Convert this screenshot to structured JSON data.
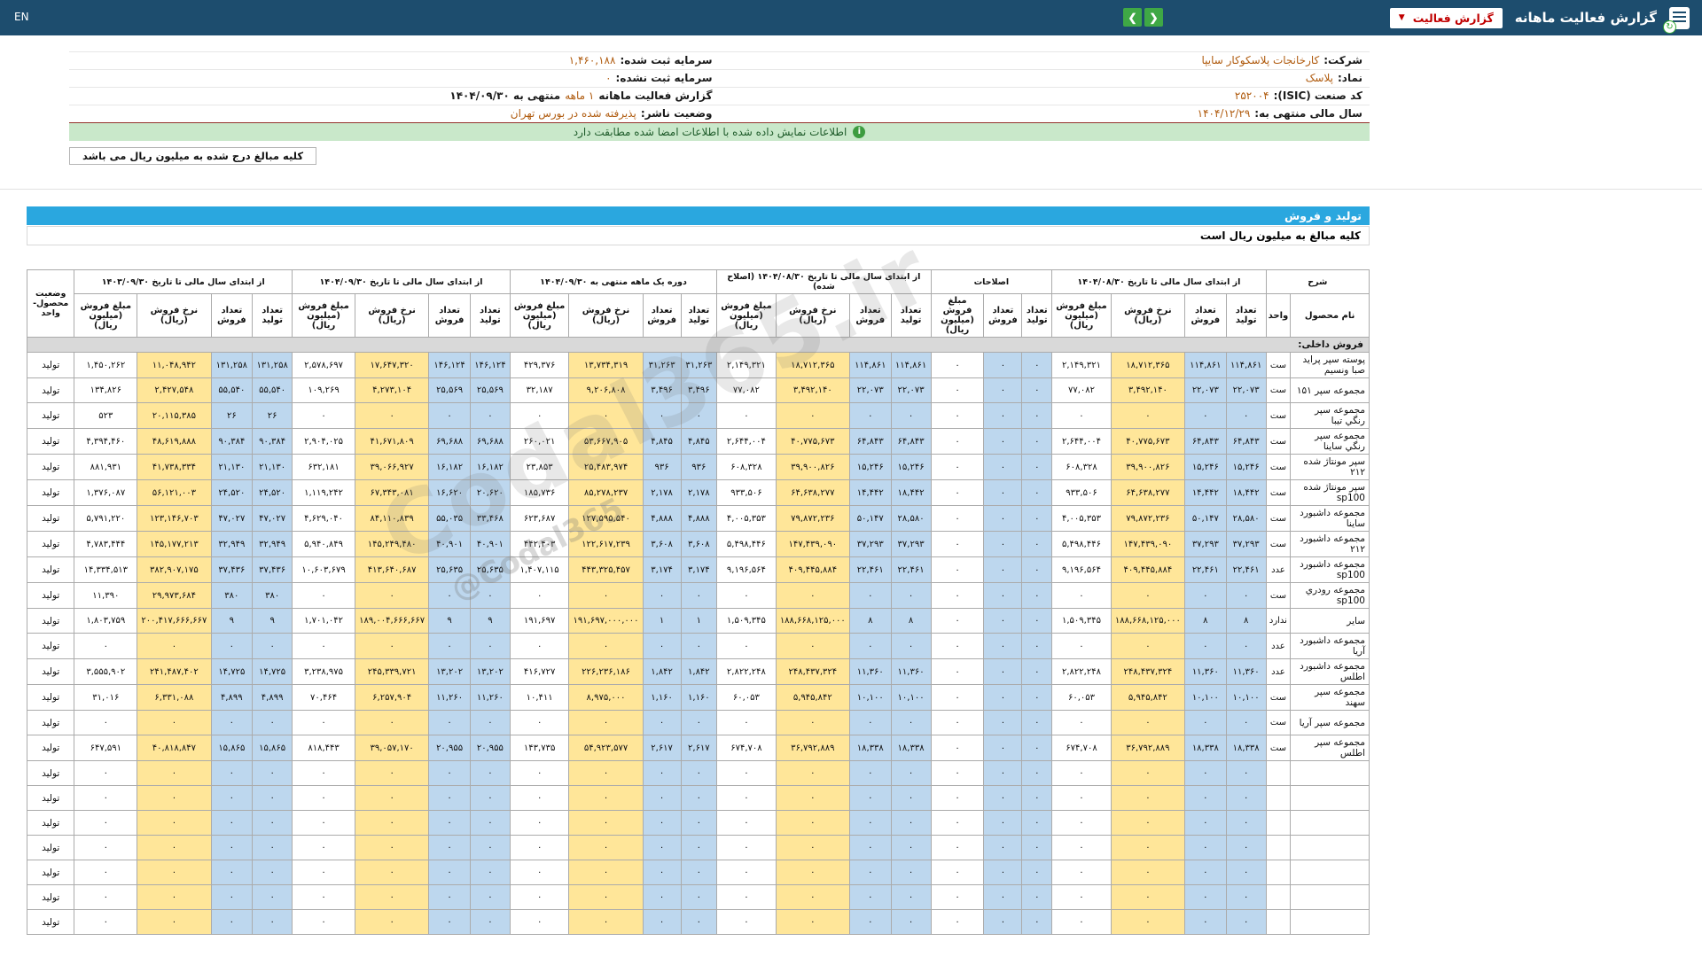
{
  "colors": {
    "navbar_bg": "#1d4d6e",
    "section_bar": "#2aa7df",
    "count_cell": "#bdd7ee",
    "rate_cell": "#ffe699",
    "accent_red": "#c00000",
    "value_orange": "#b05c10",
    "green_button": "#3fa845",
    "notice_bg": "#c9e8ca",
    "section_row_bg": "#d9d9d9"
  },
  "icons": {
    "chevron_down": "▼",
    "prev": "❮",
    "next": "❯",
    "info": "i",
    "refresh": "↻"
  },
  "navbar": {
    "title": "گزارش فعالیت ماهانه",
    "report_select": "گزارش فعالیت",
    "lang": "EN"
  },
  "company": {
    "right": [
      {
        "label": "شرکت:",
        "value": "کارخانجات پلاسکوکار سایپا"
      },
      {
        "label": "نماد:",
        "value": "پلاسک"
      },
      {
        "label": "کد صنعت (ISIC):",
        "value": "۲۵۲۰۰۴"
      },
      {
        "label": "سال مالی منتهی به:",
        "value": "۱۴۰۴/۱۲/۲۹"
      }
    ],
    "left": [
      {
        "label": "سرمایه ثبت شده:",
        "value": "۱,۴۶۰,۱۸۸"
      },
      {
        "label": "سرمایه ثبت نشده:",
        "value": "۰"
      },
      {
        "pre": "گزارش فعالیت ماهانه",
        "mid": "۱ ماهه",
        "suf": "منتهی به ۱۴۰۴/۰۹/۳۰"
      },
      {
        "label": "وضعیت ناشر:",
        "value": "پذیرفته شده در بورس تهران"
      }
    ]
  },
  "notice": "اطلاعات نمایش داده شده با اطلاعات امضا شده مطابقت دارد",
  "amounts_chip": "کلیه مبالغ درج شده به میلیون ریال می باشد",
  "section": {
    "title": "تولید و فروش",
    "note": "کلیه مبالغ به میلیون ریال است"
  },
  "watermark": {
    "main": "Codal365.ir",
    "sub": "@Codal365"
  },
  "table": {
    "desc_header": "شرح",
    "desc_cols": [
      "نام محصول",
      "واحد"
    ],
    "status_header": "وضعیت\nمحصول-واحد",
    "groups": [
      {
        "title": "از ابتدای سال مالی تا تاریخ ۱۴۰۴/۰۸/۳۰",
        "cols": [
          "تعداد تولید",
          "تعداد فروش",
          "نرخ فروش (ریال)",
          "مبلغ فروش (میلیون ریال)"
        ]
      },
      {
        "title": "اصلاحات",
        "cols": [
          "تعداد تولید",
          "تعداد فروش",
          "مبلغ فروش (میلیون ریال)"
        ]
      },
      {
        "title": "از ابتدای سال مالی تا تاریخ ۱۴۰۴/۰۸/۳۰ (اصلاح شده)",
        "cols": [
          "تعداد تولید",
          "تعداد فروش",
          "نرخ فروش (ریال)",
          "مبلغ فروش (میلیون ریال)"
        ]
      },
      {
        "title": "دوره یک ماهه منتهی به ۱۴۰۴/۰۹/۳۰",
        "cols": [
          "تعداد تولید",
          "تعداد فروش",
          "نرخ فروش (ریال)",
          "مبلغ فروش (میلیون ریال)"
        ]
      },
      {
        "title": "از ابتدای سال مالی تا تاریخ ۱۴۰۴/۰۹/۳۰",
        "cols": [
          "تعداد تولید",
          "تعداد فروش",
          "نرخ فروش (ریال)",
          "مبلغ فروش (میلیون ریال)"
        ]
      },
      {
        "title": "از ابتدای سال مالی تا تاریخ ۱۴۰۳/۰۹/۳۰",
        "cols": [
          "تعداد تولید",
          "تعداد فروش",
          "نرخ فروش (ریال)",
          "مبلغ فروش (میلیون ریال)"
        ]
      }
    ],
    "section_row": "فروش داخلی:",
    "rows": [
      {
        "name": "پوسته سپر پرايد صبا ونسيم",
        "unit": "ست",
        "status": "تولید",
        "g": [
          [
            "۱۱۴,۸۶۱",
            "۱۱۴,۸۶۱",
            "۱۸,۷۱۲,۳۶۵",
            "۲,۱۴۹,۳۲۱"
          ],
          [
            "۰",
            "۰",
            "۰"
          ],
          [
            "۱۱۴,۸۶۱",
            "۱۱۴,۸۶۱",
            "۱۸,۷۱۲,۳۶۵",
            "۲,۱۴۹,۳۲۱"
          ],
          [
            "۳۱,۲۶۳",
            "۳۱,۲۶۳",
            "۱۳,۷۳۴,۳۱۹",
            "۴۲۹,۳۷۶"
          ],
          [
            "۱۴۶,۱۲۴",
            "۱۴۶,۱۲۴",
            "۱۷,۶۴۷,۳۲۰",
            "۲,۵۷۸,۶۹۷"
          ],
          [
            "۱۳۱,۲۵۸",
            "۱۳۱,۲۵۸",
            "۱۱,۰۴۸,۹۴۲",
            "۱,۴۵۰,۲۶۲"
          ]
        ]
      },
      {
        "name": "مجموعه سپر ۱۵۱",
        "unit": "ست",
        "status": "تولید",
        "g": [
          [
            "۲۲,۰۷۳",
            "۲۲,۰۷۳",
            "۳,۴۹۲,۱۴۰",
            "۷۷,۰۸۲"
          ],
          [
            "۰",
            "۰",
            "۰"
          ],
          [
            "۲۲,۰۷۳",
            "۲۲,۰۷۳",
            "۳,۴۹۲,۱۴۰",
            "۷۷,۰۸۲"
          ],
          [
            "۳,۴۹۶",
            "۳,۴۹۶",
            "۹,۲۰۶,۸۰۸",
            "۳۲,۱۸۷"
          ],
          [
            "۲۵,۵۶۹",
            "۲۵,۵۶۹",
            "۴,۲۷۳,۱۰۴",
            "۱۰۹,۲۶۹"
          ],
          [
            "۵۵,۵۴۰",
            "۵۵,۵۴۰",
            "۲,۴۲۷,۵۴۸",
            "۱۳۴,۸۲۶"
          ]
        ]
      },
      {
        "name": "مجموعه سپر رنگي تيبا",
        "unit": "ست",
        "status": "تولید",
        "g": [
          [
            "۰",
            "۰",
            "۰",
            "۰"
          ],
          [
            "۰",
            "۰",
            "۰"
          ],
          [
            "۰",
            "۰",
            "۰",
            "۰"
          ],
          [
            "۰",
            "۰",
            "۰",
            "۰"
          ],
          [
            "۰",
            "۰",
            "۰",
            "۰"
          ],
          [
            "۲۶",
            "۲۶",
            "۲۰,۱۱۵,۳۸۵",
            "۵۲۳"
          ]
        ]
      },
      {
        "name": "مجموعه سپر رنگي ساينا",
        "unit": "ست",
        "status": "تولید",
        "g": [
          [
            "۶۴,۸۴۳",
            "۶۴,۸۴۳",
            "۴۰,۷۷۵,۶۷۳",
            "۲,۶۴۴,۰۰۴"
          ],
          [
            "۰",
            "۰",
            "۰"
          ],
          [
            "۶۴,۸۴۳",
            "۶۴,۸۴۳",
            "۴۰,۷۷۵,۶۷۳",
            "۲,۶۴۴,۰۰۴"
          ],
          [
            "۴,۸۴۵",
            "۴,۸۴۵",
            "۵۳,۶۶۷,۹۰۵",
            "۲۶۰,۰۲۱"
          ],
          [
            "۶۹,۶۸۸",
            "۶۹,۶۸۸",
            "۴۱,۶۷۱,۸۰۹",
            "۲,۹۰۴,۰۲۵"
          ],
          [
            "۹۰,۳۸۴",
            "۹۰,۳۸۴",
            "۴۸,۶۱۹,۸۸۸",
            "۴,۳۹۴,۴۶۰"
          ]
        ]
      },
      {
        "name": "سپر مونتاژ شده ۲۱۲",
        "unit": "ست",
        "status": "تولید",
        "g": [
          [
            "۱۵,۲۴۶",
            "۱۵,۲۴۶",
            "۳۹,۹۰۰,۸۲۶",
            "۶۰۸,۳۲۸"
          ],
          [
            "۰",
            "۰",
            "۰"
          ],
          [
            "۱۵,۲۴۶",
            "۱۵,۲۴۶",
            "۳۹,۹۰۰,۸۲۶",
            "۶۰۸,۳۲۸"
          ],
          [
            "۹۳۶",
            "۹۳۶",
            "۲۵,۴۸۳,۹۷۴",
            "۲۳,۸۵۳"
          ],
          [
            "۱۶,۱۸۲",
            "۱۶,۱۸۲",
            "۳۹,۰۶۶,۹۲۷",
            "۶۳۲,۱۸۱"
          ],
          [
            "۲۱,۱۳۰",
            "۲۱,۱۳۰",
            "۴۱,۷۳۸,۳۳۴",
            "۸۸۱,۹۳۱"
          ]
        ]
      },
      {
        "name": "سپر مونتاژ شده sp100",
        "unit": "ست",
        "status": "تولید",
        "g": [
          [
            "۱۸,۴۴۲",
            "۱۴,۴۴۲",
            "۶۴,۶۳۸,۲۷۷",
            "۹۳۳,۵۰۶"
          ],
          [
            "۰",
            "۰",
            "۰"
          ],
          [
            "۱۸,۴۴۲",
            "۱۴,۴۴۲",
            "۶۴,۶۳۸,۲۷۷",
            "۹۳۳,۵۰۶"
          ],
          [
            "۲,۱۷۸",
            "۲,۱۷۸",
            "۸۵,۲۷۸,۲۳۷",
            "۱۸۵,۷۳۶"
          ],
          [
            "۲۰,۶۲۰",
            "۱۶,۶۲۰",
            "۶۷,۳۴۳,۰۸۱",
            "۱,۱۱۹,۲۴۲"
          ],
          [
            "۲۴,۵۲۰",
            "۲۴,۵۲۰",
            "۵۶,۱۲۱,۰۰۳",
            "۱,۳۷۶,۰۸۷"
          ]
        ]
      },
      {
        "name": "مجموعه داشبورد ساينا",
        "unit": "ست",
        "status": "تولید",
        "g": [
          [
            "۲۸,۵۸۰",
            "۵۰,۱۴۷",
            "۷۹,۸۷۲,۲۳۶",
            "۴,۰۰۵,۳۵۳"
          ],
          [
            "۰",
            "۰",
            "۰"
          ],
          [
            "۲۸,۵۸۰",
            "۵۰,۱۴۷",
            "۷۹,۸۷۲,۲۳۶",
            "۴,۰۰۵,۳۵۳"
          ],
          [
            "۴,۸۸۸",
            "۴,۸۸۸",
            "۱۲۷,۵۹۵,۵۴۰",
            "۶۲۳,۶۸۷"
          ],
          [
            "۳۳,۴۶۸",
            "۵۵,۰۳۵",
            "۸۴,۱۱۰,۸۳۹",
            "۴,۶۲۹,۰۴۰"
          ],
          [
            "۴۷,۰۲۷",
            "۴۷,۰۲۷",
            "۱۲۳,۱۴۶,۷۰۳",
            "۵,۷۹۱,۲۲۰"
          ]
        ]
      },
      {
        "name": "مجموعه داشبورد ۲۱۲",
        "unit": "ست",
        "status": "تولید",
        "g": [
          [
            "۳۷,۲۹۳",
            "۳۷,۲۹۳",
            "۱۴۷,۴۳۹,۰۹۰",
            "۵,۴۹۸,۴۴۶"
          ],
          [
            "۰",
            "۰",
            "۰"
          ],
          [
            "۳۷,۲۹۳",
            "۳۷,۲۹۳",
            "۱۴۷,۴۳۹,۰۹۰",
            "۵,۴۹۸,۴۴۶"
          ],
          [
            "۳,۶۰۸",
            "۳,۶۰۸",
            "۱۲۲,۶۱۷,۲۳۹",
            "۴۴۲,۴۰۳"
          ],
          [
            "۴۰,۹۰۱",
            "۴۰,۹۰۱",
            "۱۴۵,۲۴۹,۴۸۰",
            "۵,۹۴۰,۸۴۹"
          ],
          [
            "۳۲,۹۴۹",
            "۳۲,۹۴۹",
            "۱۴۵,۱۷۷,۲۱۳",
            "۴,۷۸۳,۴۴۴"
          ]
        ]
      },
      {
        "name": "مجموعه داشبورد sp100",
        "unit": "عدد",
        "status": "تولید",
        "g": [
          [
            "۲۲,۴۶۱",
            "۲۲,۴۶۱",
            "۴۰۹,۴۴۵,۸۸۴",
            "۹,۱۹۶,۵۶۴"
          ],
          [
            "۰",
            "۰",
            "۰"
          ],
          [
            "۲۲,۴۶۱",
            "۲۲,۴۶۱",
            "۴۰۹,۴۴۵,۸۸۴",
            "۹,۱۹۶,۵۶۴"
          ],
          [
            "۳,۱۷۴",
            "۳,۱۷۴",
            "۴۴۳,۳۲۵,۴۵۷",
            "۱,۴۰۷,۱۱۵"
          ],
          [
            "۲۵,۶۳۵",
            "۲۵,۶۳۵",
            "۴۱۳,۶۴۰,۶۸۷",
            "۱۰,۶۰۳,۶۷۹"
          ],
          [
            "۳۷,۴۳۶",
            "۳۷,۴۳۶",
            "۳۸۲,۹۰۷,۱۷۵",
            "۱۴,۳۳۴,۵۱۳"
          ]
        ]
      },
      {
        "name": "مجموعه رودري sp100",
        "unit": "ست",
        "status": "تولید",
        "g": [
          [
            "۰",
            "۰",
            "۰",
            "۰"
          ],
          [
            "۰",
            "۰",
            "۰"
          ],
          [
            "۰",
            "۰",
            "۰",
            "۰"
          ],
          [
            "۰",
            "۰",
            "۰",
            "۰"
          ],
          [
            "۰",
            "۰",
            "۰",
            "۰"
          ],
          [
            "۳۸۰",
            "۳۸۰",
            "۲۹,۹۷۳,۶۸۴",
            "۱۱,۳۹۰"
          ]
        ]
      },
      {
        "name": "ساير",
        "unit": "ندارد",
        "status": "تولید",
        "g": [
          [
            "۸",
            "۸",
            "۱۸۸,۶۶۸,۱۲۵,۰۰۰",
            "۱,۵۰۹,۳۴۵"
          ],
          [
            "۰",
            "۰",
            "۰"
          ],
          [
            "۸",
            "۸",
            "۱۸۸,۶۶۸,۱۲۵,۰۰۰",
            "۱,۵۰۹,۳۴۵"
          ],
          [
            "۱",
            "۱",
            "۱۹۱,۶۹۷,۰۰۰,۰۰۰",
            "۱۹۱,۶۹۷"
          ],
          [
            "۹",
            "۹",
            "۱۸۹,۰۰۴,۶۶۶,۶۶۷",
            "۱,۷۰۱,۰۴۲"
          ],
          [
            "۹",
            "۹",
            "۲۰۰,۴۱۷,۶۶۶,۶۶۷",
            "۱,۸۰۳,۷۵۹"
          ]
        ]
      },
      {
        "name": "مجموعه داشبورد آريا",
        "unit": "عدد",
        "status": "تولید",
        "g": [
          [
            "۰",
            "۰",
            "۰",
            "۰"
          ],
          [
            "۰",
            "۰",
            "۰"
          ],
          [
            "۰",
            "۰",
            "۰",
            "۰"
          ],
          [
            "۰",
            "۰",
            "۰",
            "۰"
          ],
          [
            "۰",
            "۰",
            "۰",
            "۰"
          ],
          [
            "۰",
            "۰",
            "۰",
            "۰"
          ]
        ]
      },
      {
        "name": "مجموعه داشبورد اطلس",
        "unit": "عدد",
        "status": "تولید",
        "g": [
          [
            "۱۱,۳۶۰",
            "۱۱,۳۶۰",
            "۲۴۸,۴۳۷,۳۲۴",
            "۲,۸۲۲,۲۴۸"
          ],
          [
            "۰",
            "۰",
            "۰"
          ],
          [
            "۱۱,۳۶۰",
            "۱۱,۳۶۰",
            "۲۴۸,۴۳۷,۳۲۴",
            "۲,۸۲۲,۲۴۸"
          ],
          [
            "۱,۸۴۲",
            "۱,۸۴۲",
            "۲۲۶,۲۳۶,۱۸۶",
            "۴۱۶,۷۲۷"
          ],
          [
            "۱۳,۲۰۲",
            "۱۳,۲۰۲",
            "۲۴۵,۳۳۹,۷۲۱",
            "۳,۲۳۸,۹۷۵"
          ],
          [
            "۱۴,۷۲۵",
            "۱۴,۷۲۵",
            "۲۴۱,۴۸۷,۴۰۲",
            "۳,۵۵۵,۹۰۲"
          ]
        ]
      },
      {
        "name": "مجموعه سپر سهند",
        "unit": "ست",
        "status": "تولید",
        "g": [
          [
            "۱۰,۱۰۰",
            "۱۰,۱۰۰",
            "۵,۹۴۵,۸۴۲",
            "۶۰,۰۵۳"
          ],
          [
            "۰",
            "۰",
            "۰"
          ],
          [
            "۱۰,۱۰۰",
            "۱۰,۱۰۰",
            "۵,۹۴۵,۸۴۲",
            "۶۰,۰۵۳"
          ],
          [
            "۱,۱۶۰",
            "۱,۱۶۰",
            "۸,۹۷۵,۰۰۰",
            "۱۰,۴۱۱"
          ],
          [
            "۱۱,۲۶۰",
            "۱۱,۲۶۰",
            "۶,۲۵۷,۹۰۴",
            "۷۰,۴۶۴"
          ],
          [
            "۴,۸۹۹",
            "۴,۸۹۹",
            "۶,۳۳۱,۰۸۸",
            "۳۱,۰۱۶"
          ]
        ]
      },
      {
        "name": "مجموعه سپر آريا",
        "unit": "ست",
        "status": "تولید",
        "g": [
          [
            "۰",
            "۰",
            "۰",
            "۰"
          ],
          [
            "۰",
            "۰",
            "۰"
          ],
          [
            "۰",
            "۰",
            "۰",
            "۰"
          ],
          [
            "۰",
            "۰",
            "۰",
            "۰"
          ],
          [
            "۰",
            "۰",
            "۰",
            "۰"
          ],
          [
            "۰",
            "۰",
            "۰",
            "۰"
          ]
        ]
      },
      {
        "name": "مجموعه سپر اطلس",
        "unit": "ست",
        "status": "تولید",
        "g": [
          [
            "۱۸,۳۳۸",
            "۱۸,۳۳۸",
            "۳۶,۷۹۲,۸۸۹",
            "۶۷۴,۷۰۸"
          ],
          [
            "۰",
            "۰",
            "۰"
          ],
          [
            "۱۸,۳۳۸",
            "۱۸,۳۳۸",
            "۳۶,۷۹۲,۸۸۹",
            "۶۷۴,۷۰۸"
          ],
          [
            "۲,۶۱۷",
            "۲,۶۱۷",
            "۵۴,۹۲۳,۵۷۷",
            "۱۴۳,۷۳۵"
          ],
          [
            "۲۰,۹۵۵",
            "۲۰,۹۵۵",
            "۳۹,۰۵۷,۱۷۰",
            "۸۱۸,۴۴۳"
          ],
          [
            "۱۵,۸۶۵",
            "۱۵,۸۶۵",
            "۴۰,۸۱۸,۸۴۷",
            "۶۴۷,۵۹۱"
          ]
        ]
      }
    ],
    "clipped_filler_rows": 7
  }
}
